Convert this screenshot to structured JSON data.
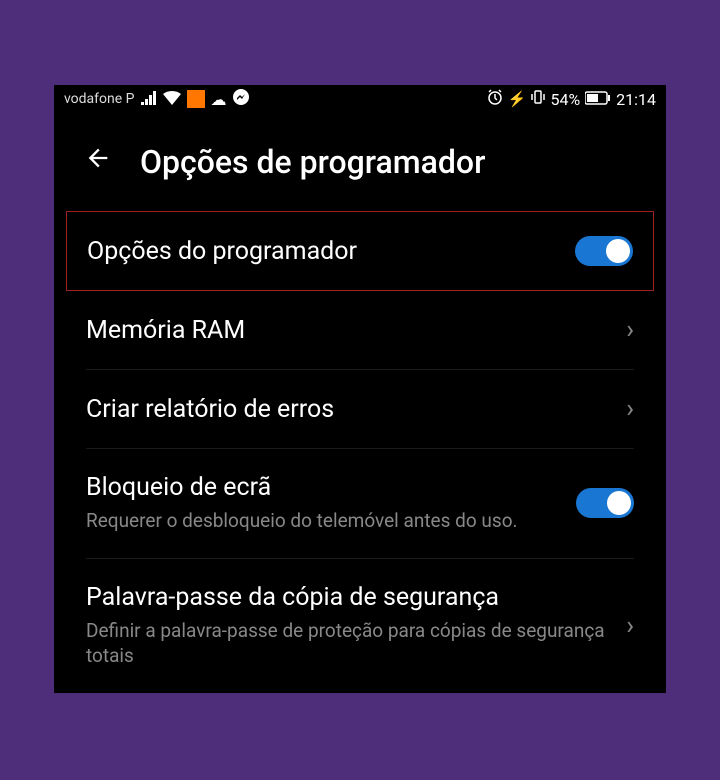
{
  "statusBar": {
    "carrier": "vodafone P",
    "battery": "54%",
    "time": "21:14"
  },
  "header": {
    "title": "Opções de programador"
  },
  "highlighted": {
    "label": "Opções do programador",
    "toggled": true
  },
  "rows": [
    {
      "label": "Memória RAM",
      "type": "chevron"
    },
    {
      "label": "Criar relatório de erros",
      "type": "chevron"
    },
    {
      "label": "Bloqueio de ecrã",
      "subtitle": "Requerer o desbloqueio do telemóvel antes do uso.",
      "type": "toggle",
      "toggled": true
    },
    {
      "label": "Palavra-passe da cópia de segurança",
      "subtitle": "Definir a palavra-passe de proteção para cópias de segurança totais",
      "type": "chevron"
    }
  ]
}
